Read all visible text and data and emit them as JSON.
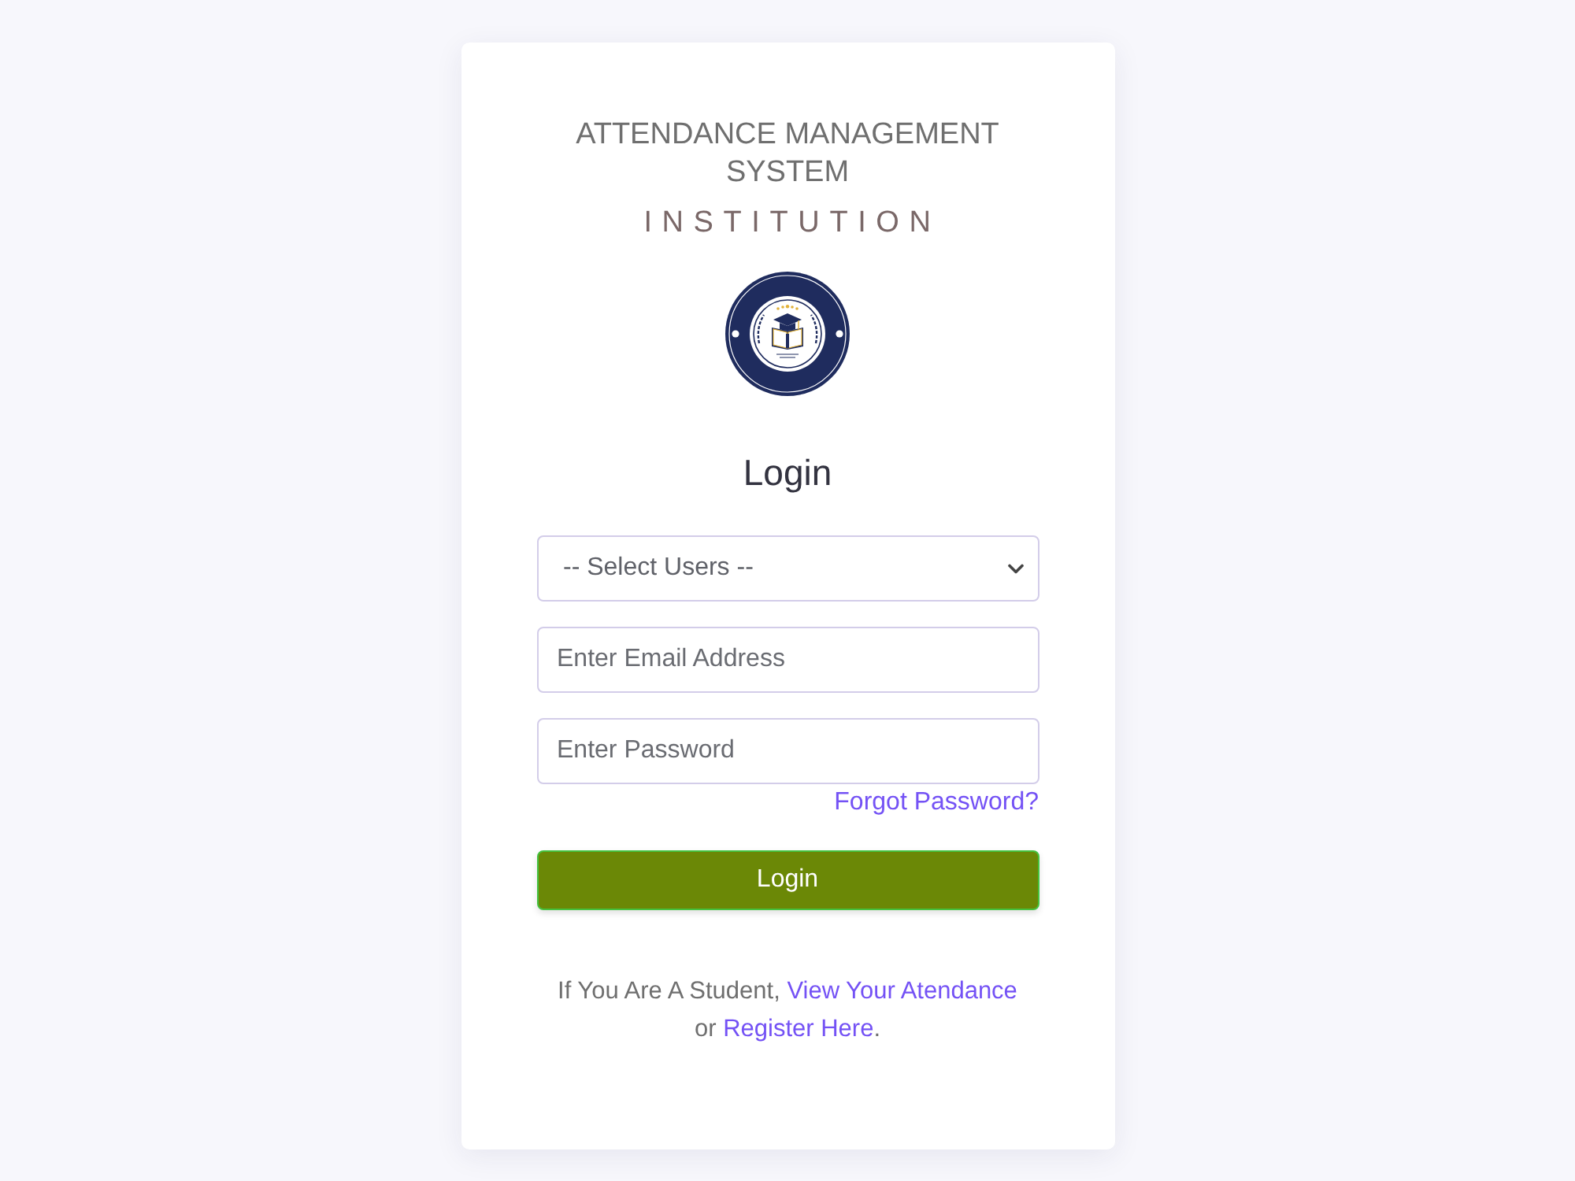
{
  "header": {
    "title": "ATTENDANCE MANAGEMENT SYSTEM",
    "subtitle": "INSTITUTION"
  },
  "login": {
    "heading": "Login",
    "fields": [
      {
        "kind": "select",
        "value": "-- Select Users --"
      },
      {
        "kind": "email",
        "placeholder": "Enter Email Address"
      },
      {
        "kind": "password",
        "placeholder": "Enter Password"
      }
    ],
    "forgot_link": "Forgot Password?",
    "button": "Login"
  },
  "footer": {
    "parts": [
      {
        "kind": "text",
        "text": "If You Are A Student, "
      },
      {
        "kind": "link",
        "text": "View Your Atendance"
      },
      {
        "kind": "text",
        "text": " or "
      },
      {
        "kind": "link",
        "text": "Register Here"
      },
      {
        "kind": "text",
        "text": "."
      }
    ]
  }
}
